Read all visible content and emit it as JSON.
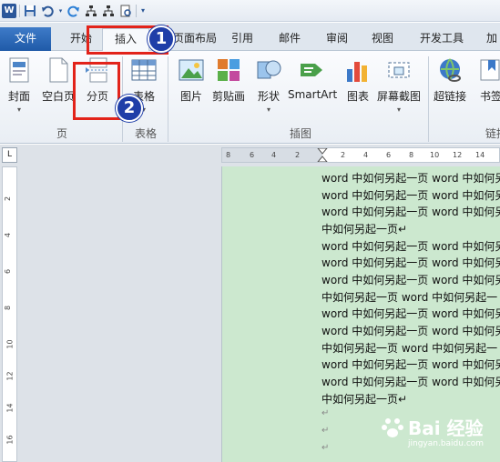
{
  "qat": {
    "logo": "W",
    "icons": [
      "save-icon",
      "undo-icon",
      "redo-icon",
      "org-chart-icon",
      "org-chart-icon",
      "print-preview-icon",
      "customize-icon"
    ]
  },
  "tabs": {
    "file": "文件",
    "items": [
      "开始",
      "插入",
      "页面布局",
      "引用",
      "邮件",
      "审阅",
      "视图",
      "开发工具",
      "加"
    ]
  },
  "ribbon": {
    "buttons": {
      "cover": "封面",
      "blank": "空白页",
      "pagebreak": "分页",
      "table": "表格",
      "picture": "图片",
      "clipart": "剪贴画",
      "shapes": "形状",
      "smartart": "SmartArt",
      "chart": "图表",
      "screenshot": "屏幕截图",
      "hyperlink": "超链接",
      "bookmark": "书签"
    },
    "groups": {
      "pages": "页",
      "tables": "表格",
      "illustrations": "插图",
      "links": "链接"
    }
  },
  "annotations": {
    "badge1": "1",
    "badge2": "2"
  },
  "ruler": {
    "top": [
      "8",
      "6",
      "4",
      "2",
      "2",
      "4",
      "6",
      "8",
      "10",
      "12",
      "14"
    ],
    "left": [
      "2",
      "4",
      "6",
      "8",
      "10",
      "12",
      "14",
      "16"
    ]
  },
  "document": {
    "lines": [
      "word 中如何另起一页 word 中如何另",
      "word 中如何另起一页 word 中如何另",
      "word 中如何另起一页 word 中如何另",
      "中如何另起一页↵",
      "word 中如何另起一页 word 中如何另",
      "word 中如何另起一页 word 中如何另",
      "word 中如何另起一页 word 中如何另",
      "中如何另起一页 word 中如何另起一",
      "word 中如何另起一页 word 中如何另",
      "word 中如何另起一页 word 中如何另",
      "中如何另起一页 word 中如何另起一",
      "word 中如何另起一页 word 中如何另",
      "word 中如何另起一页 word 中如何另",
      "中如何另起一页↵",
      "↵",
      "↵",
      "↵"
    ]
  },
  "watermark": {
    "brand": "Bai 经验",
    "url": "jingyan.baidu.com"
  }
}
